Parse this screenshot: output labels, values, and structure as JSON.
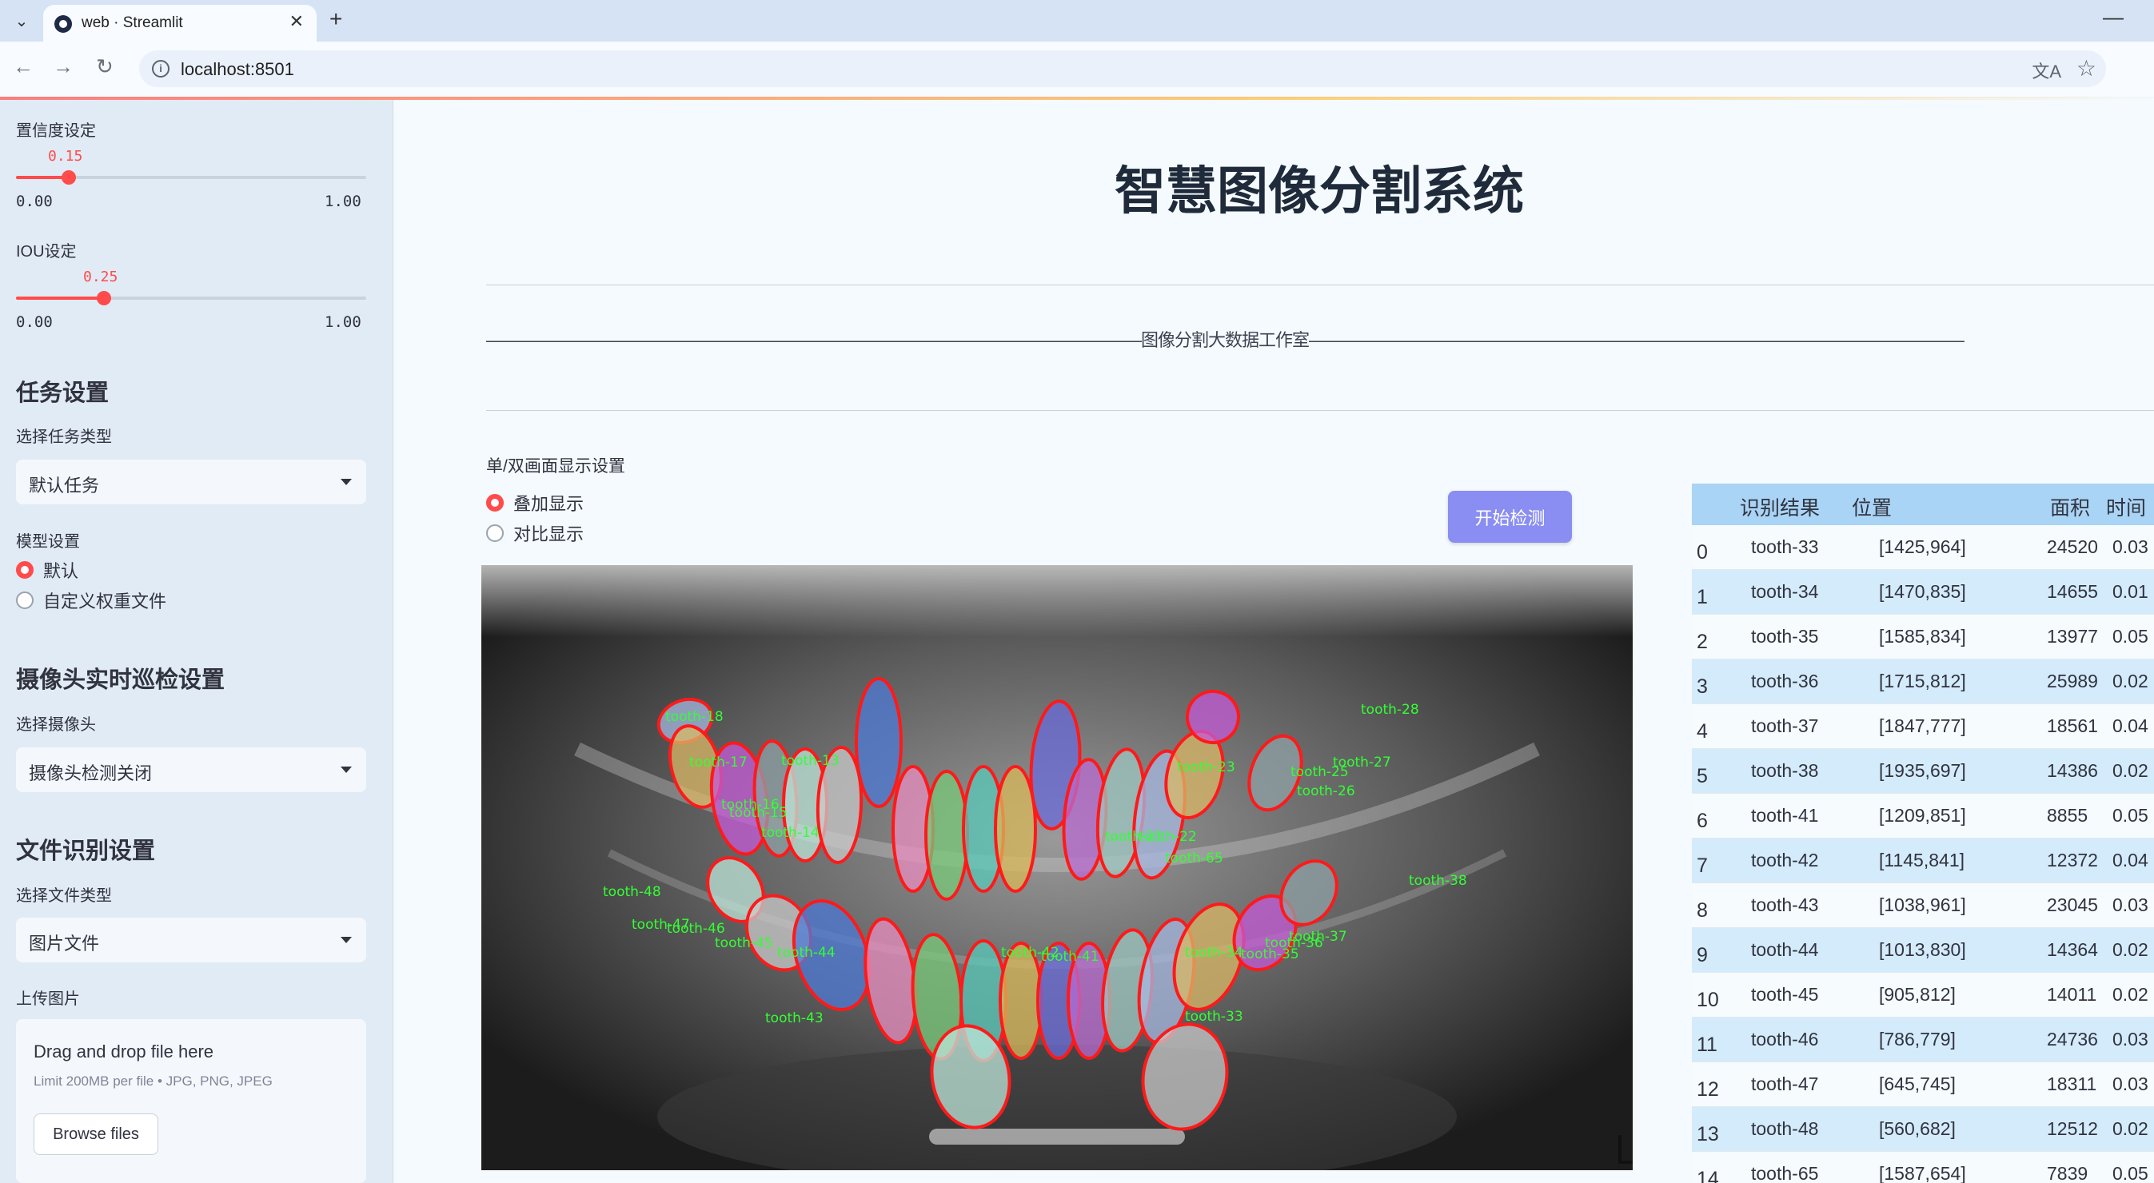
{
  "browser": {
    "tab_title": "web · Streamlit",
    "url": "localhost:8501"
  },
  "sidebar": {
    "conf_label": "置信度设定",
    "conf_value": "0.15",
    "conf_fraction": 0.15,
    "iou_label": "IOU设定",
    "iou_value": "0.25",
    "iou_fraction": 0.25,
    "slider_min": "0.00",
    "slider_max": "1.00",
    "task_heading": "任务设置",
    "task_type_label": "选择任务类型",
    "task_type_value": "默认任务",
    "model_label": "模型设置",
    "model_options": [
      "默认",
      "自定义权重文件"
    ],
    "model_selected": "默认",
    "camera_heading": "摄像头实时巡检设置",
    "camera_label": "选择摄像头",
    "camera_value": "摄像头检测关闭",
    "file_heading": "文件识别设置",
    "file_type_label": "选择文件类型",
    "file_type_value": "图片文件",
    "upload_label": "上传图片",
    "upload_title": "Drag and drop file here",
    "upload_limit": "Limit 200MB per file • JPG, PNG, JPEG",
    "browse_label": "Browse files"
  },
  "main": {
    "title": "智慧图像分割系统",
    "studio_banner": "———————————————————————————————————————图像分割大数据工作室———————————————————————————————————————",
    "display_label": "单/双画面显示设置",
    "display_options": [
      "叠加显示",
      "对比显示"
    ],
    "display_selected": "叠加显示",
    "start_button": "开始检测"
  },
  "table": {
    "headers": [
      "识别结果",
      "位置",
      "面积",
      "时间"
    ],
    "rows": [
      [
        "0",
        "tooth-33",
        "[1425,964]",
        "24520",
        "0.03"
      ],
      [
        "1",
        "tooth-34",
        "[1470,835]",
        "14655",
        "0.01"
      ],
      [
        "2",
        "tooth-35",
        "[1585,834]",
        "13977",
        "0.05"
      ],
      [
        "3",
        "tooth-36",
        "[1715,812]",
        "25989",
        "0.02"
      ],
      [
        "4",
        "tooth-37",
        "[1847,777]",
        "18561",
        "0.04"
      ],
      [
        "5",
        "tooth-38",
        "[1935,697]",
        "14386",
        "0.02"
      ],
      [
        "6",
        "tooth-41",
        "[1209,851]",
        "8855",
        "0.05"
      ],
      [
        "7",
        "tooth-42",
        "[1145,841]",
        "12372",
        "0.04"
      ],
      [
        "8",
        "tooth-43",
        "[1038,961]",
        "23045",
        "0.03"
      ],
      [
        "9",
        "tooth-44",
        "[1013,830]",
        "14364",
        "0.02"
      ],
      [
        "10",
        "tooth-45",
        "[905,812]",
        "14011",
        "0.02"
      ],
      [
        "11",
        "tooth-46",
        "[786,779]",
        "24736",
        "0.03"
      ],
      [
        "12",
        "tooth-47",
        "[645,745]",
        "18311",
        "0.03"
      ],
      [
        "13",
        "tooth-48",
        "[560,682]",
        "12512",
        "0.02"
      ],
      [
        "14",
        "tooth-65",
        "[1587,654]",
        "7839",
        "0.05"
      ]
    ]
  },
  "xray": {
    "labels": [
      "tooth-18",
      "tooth-17",
      "tooth-16",
      "tooth-15",
      "tooth-14",
      "tooth-13",
      "tooth-28",
      "tooth-27",
      "tooth-26",
      "tooth-25",
      "tooth-23",
      "tooth-21",
      "tooth-22",
      "tooth-65",
      "tooth-38",
      "tooth-48",
      "tooth-47",
      "tooth-46",
      "tooth-45",
      "tooth-44",
      "tooth-43",
      "tooth-42",
      "tooth-41",
      "tooth-33",
      "tooth-34",
      "tooth-35",
      "tooth-36",
      "tooth-37"
    ]
  },
  "colors": {
    "accent": "#ff4b4b",
    "button": "#8a8ef2",
    "table_header": "#a9d4f5",
    "row_alt": "#d4ebfb",
    "mask_outline": "#ff1a1a",
    "label_text": "#33ff33"
  }
}
